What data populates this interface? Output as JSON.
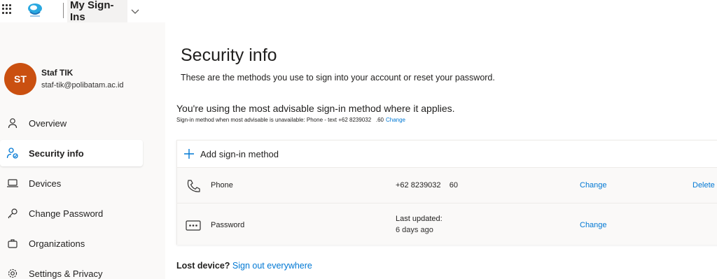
{
  "header": {
    "app_name": "My Sign-Ins"
  },
  "user": {
    "initials": "ST",
    "name": "Staf TIK",
    "email": "staf-tik@polibatam.ac.id",
    "avatar_color": "#ca5010"
  },
  "nav": {
    "items": [
      {
        "label": "Overview",
        "icon": "person-icon"
      },
      {
        "label": "Security info",
        "icon": "security-info-icon",
        "active": true
      },
      {
        "label": "Devices",
        "icon": "laptop-icon"
      },
      {
        "label": "Change Password",
        "icon": "key-icon"
      },
      {
        "label": "Organizations",
        "icon": "briefcase-icon"
      },
      {
        "label": "Settings & Privacy",
        "icon": "gear-icon"
      }
    ]
  },
  "main": {
    "title": "Security info",
    "subtitle": "These are the methods you use to sign into your account or reset your password.",
    "advisable": "You're using the most advisable sign-in method where it applies.",
    "fallback_text": "Sign-in method when most advisable is unavailable: Phone - text +62 8239032   .60",
    "fallback_change": "Change",
    "add_method": "Add sign-in method",
    "methods": [
      {
        "name": "Phone",
        "value": "+62 8239032    60",
        "change": "Change",
        "delete": "Delete",
        "icon": "phone-icon"
      },
      {
        "name": "Password",
        "value_label": "Last updated:",
        "value": "6 days ago",
        "change": "Change",
        "icon": "password-icon"
      }
    ],
    "lost_device_label": "Lost device?",
    "sign_out_everywhere": "Sign out everywhere"
  },
  "colors": {
    "accent": "#0078d4",
    "text": "#201f1e"
  }
}
